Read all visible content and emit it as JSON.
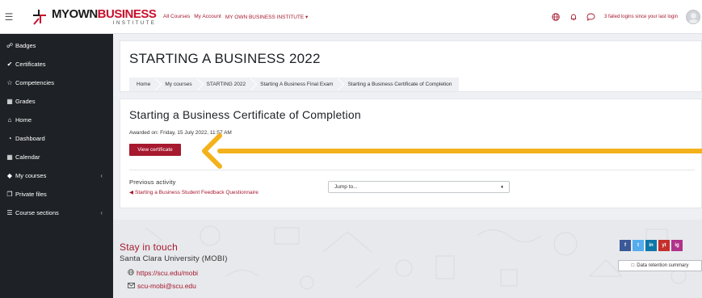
{
  "navbar": {
    "logo_main_left": "MYOWN",
    "logo_main_right": "BUSINESS",
    "logo_sub": "INSTITUTE",
    "links": [
      "All Courses",
      "My Account",
      "MY OWN BUSINESS INSTITUTE ▾"
    ],
    "failed_logins": "3 failed logins since your last login"
  },
  "sidebar": {
    "items": [
      {
        "label": "Badges",
        "icon": "badge-icon"
      },
      {
        "label": "Certificates",
        "icon": "certificate-icon"
      },
      {
        "label": "Competencies",
        "icon": "star-icon"
      },
      {
        "label": "Grades",
        "icon": "grades-icon"
      },
      {
        "label": "Home",
        "icon": "home-icon"
      },
      {
        "label": "Dashboard",
        "icon": "dashboard-icon"
      },
      {
        "label": "Calendar",
        "icon": "calendar-icon"
      },
      {
        "label": "My courses",
        "icon": "graduation-cap-icon"
      },
      {
        "label": "Private files",
        "icon": "files-icon"
      },
      {
        "label": "Course sections",
        "icon": "list-icon"
      }
    ]
  },
  "header": {
    "course_title": "STARTING A BUSINESS 2022",
    "breadcrumb": [
      "Home",
      "My courses",
      "STARTING 2022",
      "Starting A Business Final Exam",
      "Starting a Business Certificate of Completion"
    ]
  },
  "activity": {
    "title": "Starting a Business Certificate of Completion",
    "awarded": "Awarded on: Friday, 15 July 2022, 11:57 AM",
    "view_button": "View certificate",
    "previous_label": "Previous activity",
    "previous_link": "Starting a Business Student Feedback Questionnaire",
    "jump_placeholder": "Jump to..."
  },
  "footer": {
    "stay_in_touch": "Stay in touch",
    "org": "Santa Clara University (MOBI)",
    "website": "https://scu.edu/mobi",
    "email": "scu-mobi@scu.edu",
    "socials": [
      "f",
      "t",
      "in",
      "yt",
      "ig"
    ],
    "retention": "Data retention summary"
  },
  "colors": {
    "brand": "#a6192e",
    "sidebar_bg": "#1e2125",
    "arrow": "#f3b21b",
    "facebook": "#3b5998",
    "twitter": "#55acee",
    "linkedin": "#0e76a8",
    "youtube": "#c4302b",
    "instagram": "#b0328a"
  }
}
